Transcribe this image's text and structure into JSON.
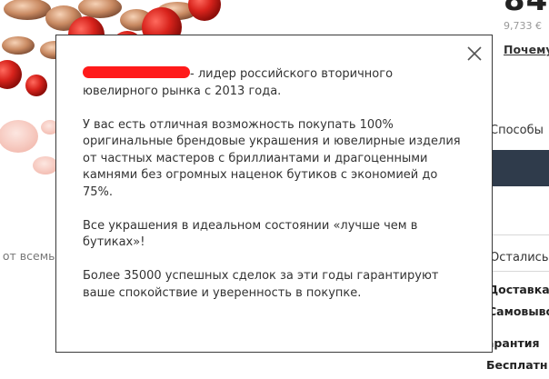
{
  "background": {
    "strip_text": "t от всемь",
    "price_big": "84",
    "old_price": "9,733 €",
    "why_link": "Почему",
    "payment_label": "Способы",
    "remaining_label": "Остались",
    "delivery_label": "Доставка",
    "pickup_label": "Самовыво",
    "guarantee_label": "арантия",
    "free_label": "Бесплатн"
  },
  "modal": {
    "intro_suffix": "- лидер российского вторичного ювелирного рынка с 2013 года.",
    "paragraph_2": "У вас есть отличная возможность покупать 100% оригинальные брендовые украшения и ювелирные изделия от частных мастеров с бриллиантами и драгоценными камнями без огромных наценок бутиков с экономией до 75%.",
    "paragraph_3": "Все украшения в идеальном состоянии «лучше чем в бутиках»!",
    "paragraph_4": "Более 35000 успешных сделок за эти годы гарантируют ваше спокойствие и уверенность в покупке.",
    "close_icon": "close-icon",
    "redaction_color": "#ff1a1a"
  }
}
